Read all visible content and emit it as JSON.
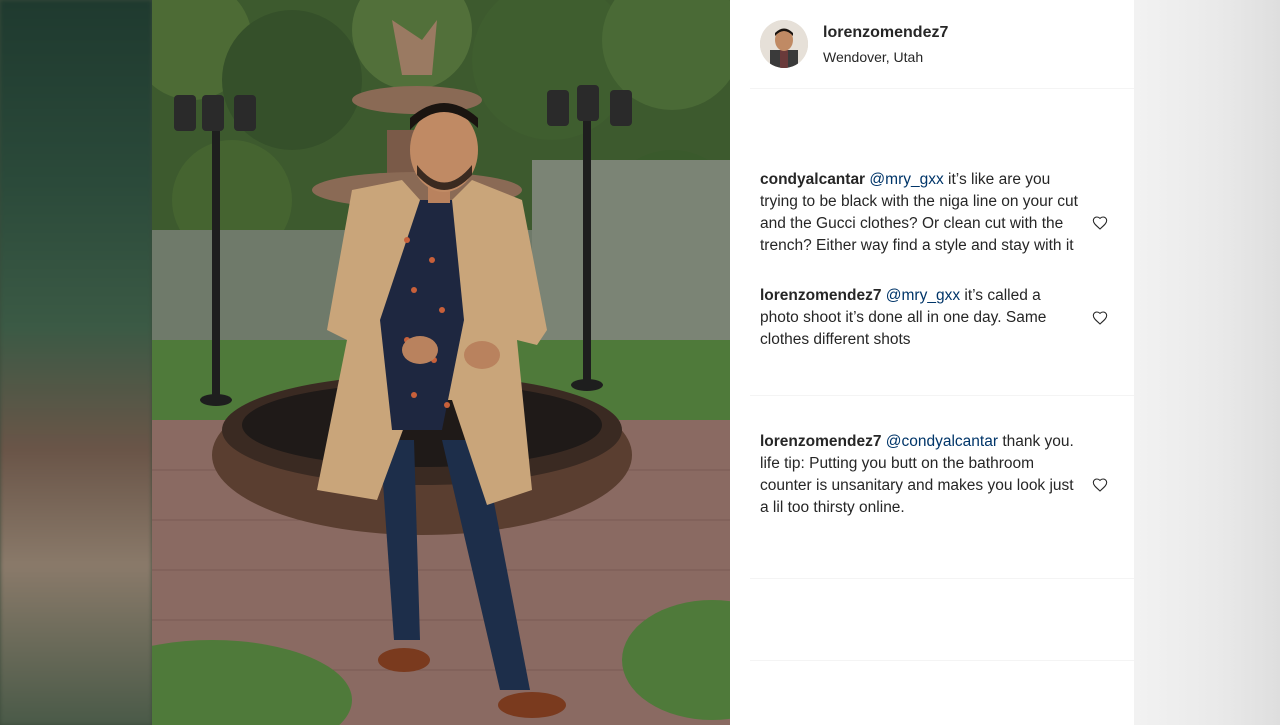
{
  "post": {
    "username": "lorenzomendez7",
    "location": "Wendover, Utah"
  },
  "comments": [
    {
      "author": "condyalcantar",
      "mention": "@mry_gxx",
      "text": " it’s like are you trying to be black with the niga line on your cut and the Gucci clothes? Or clean cut with the trench? Either way find a style and stay with it",
      "icon": "heart-outline-icon"
    },
    {
      "author": "lorenzomendez7",
      "mention": "@mry_gxx",
      "text": " it’s called a photo shoot it’s done all in one day. Same clothes different shots",
      "icon": "heart-outline-icon"
    },
    {
      "author": "lorenzomendez7",
      "mention": "@condyalcantar",
      "text": " thank you. life tip: Putting you butt on the bathroom counter is unsanitary and makes you look just a lil too thirsty online.",
      "icon": "heart-outline-icon"
    }
  ],
  "colors": {
    "text": "#262626",
    "mention": "#003569",
    "panel_bg": "#ffffff"
  }
}
